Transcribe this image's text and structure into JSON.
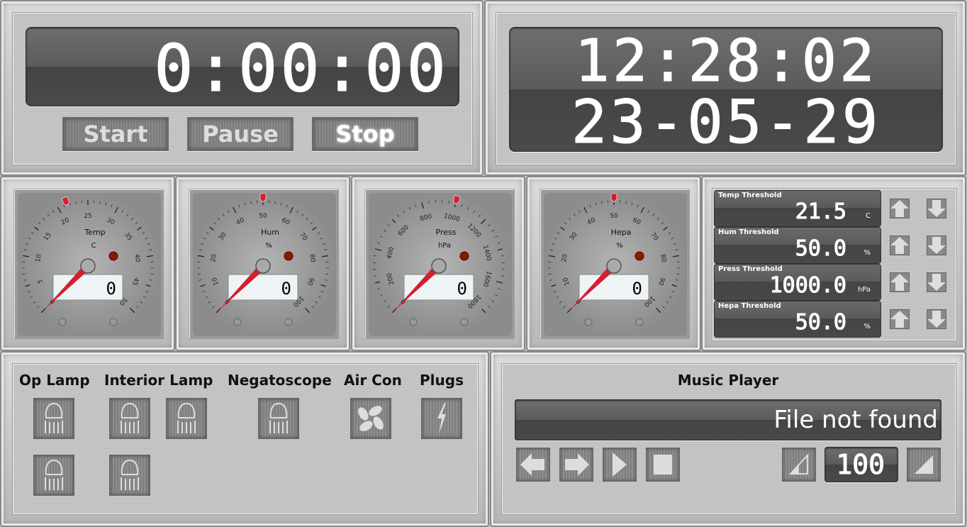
{
  "timer": {
    "display": "0:00:00",
    "buttons": [
      {
        "label": "Start"
      },
      {
        "label": "Pause"
      },
      {
        "label": "Stop"
      }
    ]
  },
  "clock": {
    "time": "12:28:02",
    "date": "23-05-29"
  },
  "gauges": [
    {
      "title": "Temp",
      "unit": "C",
      "min": 0,
      "max": 50,
      "step": 5,
      "value": 0,
      "display": "0",
      "threshold": 21.5
    },
    {
      "title": "Hum",
      "unit": "%",
      "min": 0,
      "max": 100,
      "step": 10,
      "value": 0,
      "display": "0",
      "threshold": 50
    },
    {
      "title": "Press",
      "unit": "hPa",
      "min": 0,
      "max": 1800,
      "step": 200,
      "value": 0,
      "display": "0",
      "threshold": 1000
    },
    {
      "title": "Hepa",
      "unit": "%",
      "min": 0,
      "max": 100,
      "step": 10,
      "value": 0,
      "display": "0",
      "threshold": 50
    }
  ],
  "thresholds": [
    {
      "label": "Temp Threshold",
      "value": "21.5",
      "unit": "C"
    },
    {
      "label": "Hum Threshold",
      "value": "50.0",
      "unit": "%"
    },
    {
      "label": "Press Threshold",
      "value": "1000.0",
      "unit": "hPa"
    },
    {
      "label": "Hepa Threshold",
      "value": "50.0",
      "unit": "%"
    }
  ],
  "controls": {
    "labels": [
      "Op Lamp",
      "Interior Lamp",
      "Negatoscope",
      "Air Con",
      "Plugs"
    ]
  },
  "music": {
    "title": "Music Player",
    "status": "File not found",
    "volume": "100"
  },
  "colors": {
    "needle": "#d0202e",
    "led": "#8a1a00",
    "lcd": "#4a4a4a"
  }
}
